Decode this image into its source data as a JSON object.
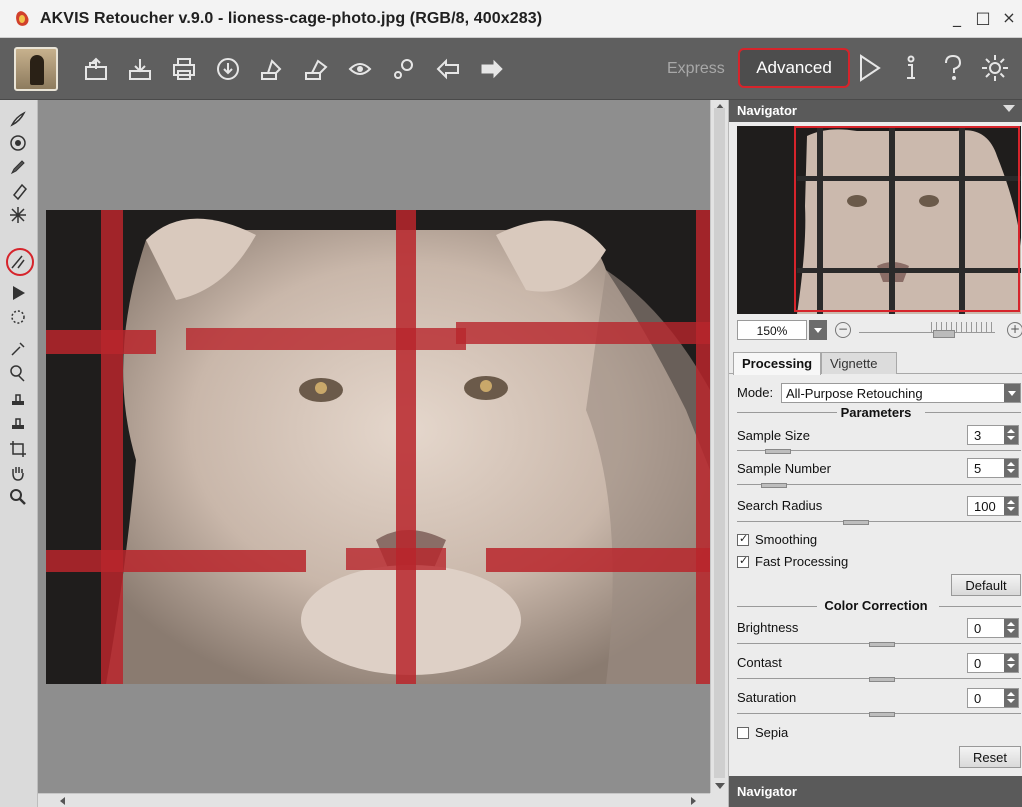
{
  "window": {
    "title": "AKVIS Retoucher v.9.0 - lioness-cage-photo.jpg (RGB/8, 400x283)",
    "controls": [
      "_",
      "□",
      "×"
    ]
  },
  "toolbar": {
    "icons": [
      "logo-icon",
      "open-icon",
      "save-icon",
      "print-icon",
      "share-icon",
      "batch-icon",
      "plugin-icon",
      "preferences-icon",
      "settings-icon",
      "undo-icon",
      "redo-icon"
    ],
    "modes": {
      "express": "Express",
      "advanced": "Advanced"
    },
    "right_icons": [
      "run-icon",
      "info-icon",
      "help-icon",
      "gear-icon"
    ]
  },
  "tools": [
    "brush-icon",
    "healing-icon",
    "pencil-icon",
    "eraser-icon",
    "magic-wand-icon",
    "smart-retouch-icon",
    "play-icon",
    "stamp-select-icon",
    "dropper-icon",
    "chameleon-icon",
    "clone-stamp-icon",
    "patch-stamp-icon",
    "crop-icon",
    "hand-icon",
    "zoom-icon"
  ],
  "colors": {
    "accent_red": "#d6242b",
    "mask_red": "#b8262c",
    "panel_header": "#5a5a5a"
  },
  "navigator": {
    "title": "Navigator",
    "zoom": "150%"
  },
  "tabs": {
    "processing": "Processing",
    "vignette": "Vignette"
  },
  "processing": {
    "mode_label": "Mode:",
    "mode_value": "All-Purpose Retouching",
    "parameters_title": "Parameters",
    "sample_size": {
      "label": "Sample Size",
      "value": "3"
    },
    "sample_number": {
      "label": "Sample Number",
      "value": "5"
    },
    "search_radius": {
      "label": "Search Radius",
      "value": "100"
    },
    "smoothing": {
      "label": "Smoothing",
      "checked": true
    },
    "fast_processing": {
      "label": "Fast Processing",
      "checked": true
    },
    "default_button": "Default",
    "color_correction_title": "Color Correction",
    "brightness": {
      "label": "Brightness",
      "value": "0"
    },
    "contrast": {
      "label": "Contast",
      "value": "0"
    },
    "saturation": {
      "label": "Saturation",
      "value": "0"
    },
    "sepia": {
      "label": "Sepia",
      "checked": false
    },
    "reset_button": "Reset"
  },
  "footer": {
    "navigator": "Navigator"
  }
}
